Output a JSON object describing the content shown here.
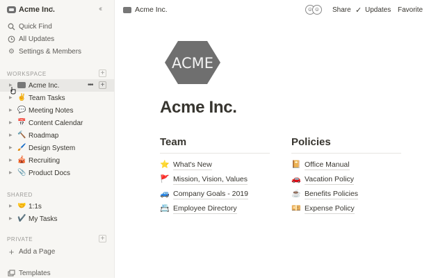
{
  "sidebar": {
    "workspace_name": "Acme Inc.",
    "quick_find": "Quick Find",
    "all_updates": "All Updates",
    "settings": "Settings & Members",
    "workspace_label": "WORKSPACE",
    "workspace_items": [
      {
        "emoji": "",
        "label": "Acme Inc."
      },
      {
        "emoji": "✌️",
        "label": "Team Tasks"
      },
      {
        "emoji": "💬",
        "label": "Meeting Notes"
      },
      {
        "emoji": "📅",
        "label": "Content Calendar"
      },
      {
        "emoji": "🔨",
        "label": "Roadmap"
      },
      {
        "emoji": "🖌️",
        "label": "Design System"
      },
      {
        "emoji": "🎪",
        "label": "Recruiting"
      },
      {
        "emoji": "📎",
        "label": "Product Docs"
      }
    ],
    "shared_label": "SHARED",
    "shared_items": [
      {
        "emoji": "🤝",
        "label": "1:1s"
      },
      {
        "emoji": "✔️",
        "label": "My Tasks"
      }
    ],
    "private_label": "PRIVATE",
    "add_page": "Add a Page",
    "templates": "Templates"
  },
  "topbar": {
    "breadcrumb": "Acme Inc.",
    "share": "Share",
    "updates": "Updates",
    "favorite": "Favorite"
  },
  "page": {
    "logo_text": "ACME",
    "title": "Acme Inc.",
    "team_heading": "Team",
    "policies_heading": "Policies",
    "team_links": [
      {
        "emoji": "⭐",
        "label": "What's New"
      },
      {
        "emoji": "🚩",
        "label": "Mission, Vision, Values"
      },
      {
        "emoji": "🚙",
        "label": "Company Goals - 2019"
      },
      {
        "emoji": "📇",
        "label": "Employee Directory"
      }
    ],
    "policy_links": [
      {
        "emoji": "📔",
        "label": "Office Manual"
      },
      {
        "emoji": "🚗",
        "label": "Vacation Policy"
      },
      {
        "emoji": "☕",
        "label": "Benefits Policies"
      },
      {
        "emoji": "💴",
        "label": "Expense Policy"
      }
    ]
  },
  "colors": {
    "sidebar_bg": "#f7f6f3",
    "text": "#37352f",
    "logo_grey": "#6f6f6f"
  }
}
